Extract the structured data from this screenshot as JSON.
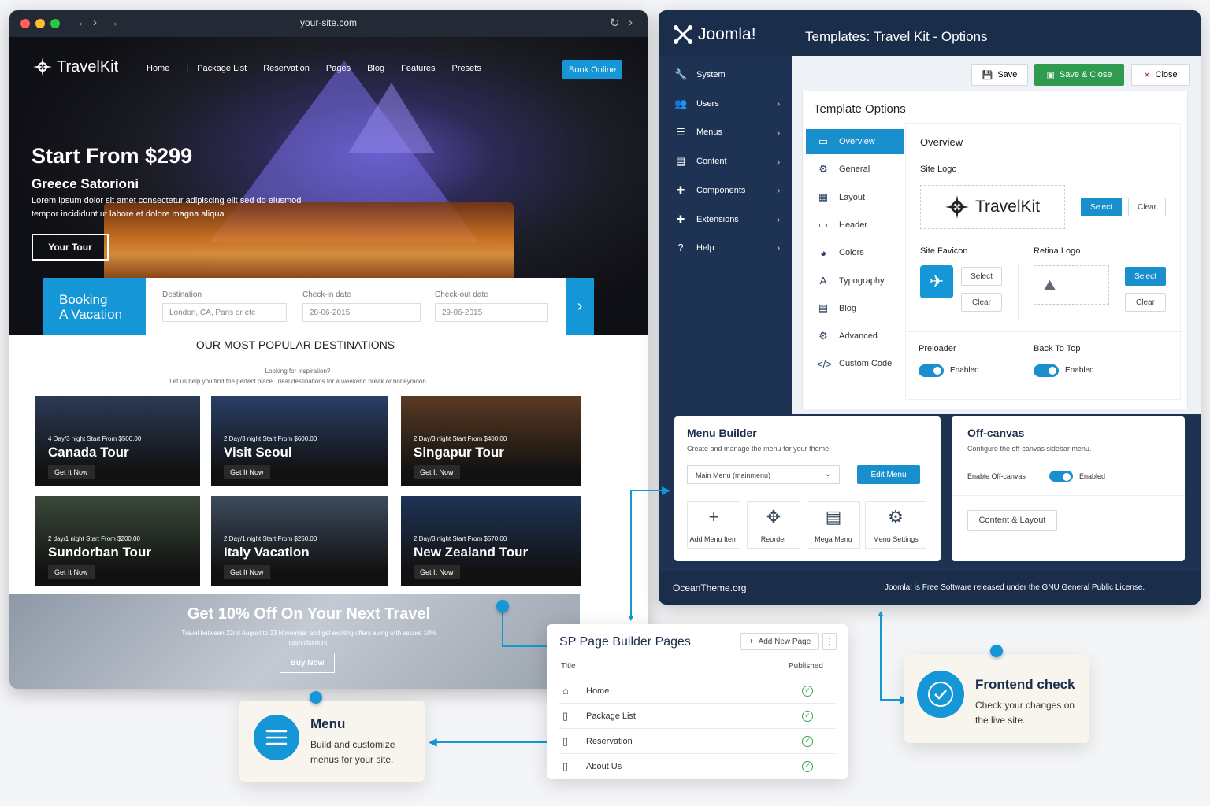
{
  "browser": {
    "url": "your-site.com"
  },
  "site": {
    "logo": "TravelKit",
    "nav": [
      "Home",
      "Package List",
      "Reservation",
      "Pages",
      "Blog",
      "Features",
      "Presets"
    ],
    "book_online": "Book Online",
    "hero": {
      "title": "Start From $299",
      "subtitle": "Greece Satorioni",
      "desc": "Lorem ipsum dolor sit amet consectetur adipiscing elit sed do eiusmod tempor incididunt ut labore et dolore magna aliqua",
      "cta": "Your Tour"
    },
    "booking": {
      "title_line1": "Booking",
      "title_line2": "A Vacation",
      "destination_label": "Destination",
      "destination_placeholder": "London, CA, Paris or etc",
      "checkin_label": "Check-in date",
      "checkin_value": "28-06-2015",
      "checkout_label": "Check-out date",
      "checkout_value": "29-06-2015"
    },
    "popular": {
      "title": "OUR MOST POPULAR DESTINATIONS",
      "sub1": "Looking for inspiration?",
      "sub2": "Let us help you find the perfect place. Ideal destinations for a weekend break or honeymoon",
      "cards": [
        {
          "tag": "4 Day/3 night Start From $500.00",
          "name": "Canada Tour",
          "btn": "Get It Now",
          "bg": "#2b3a55"
        },
        {
          "tag": "2 Day/3 night Start From $600.00",
          "name": "Visit Seoul",
          "btn": "Get It Now",
          "bg": "#2a3f66"
        },
        {
          "tag": "2 Day/3 night Start From $400.00",
          "name": "Singapur Tour",
          "btn": "Get It Now",
          "bg": "#5a3a22"
        },
        {
          "tag": "2 day/1 night Start From $200.00",
          "name": "Sundorban Tour",
          "btn": "Get It Now",
          "bg": "#3a4a3a"
        },
        {
          "tag": "2 Day/1 night Start From $250.00",
          "name": "Italy Vacation",
          "btn": "Get It Now",
          "bg": "#3d4a5e"
        },
        {
          "tag": "2 Day/3 night Start From $570.00",
          "name": "New Zealand Tour",
          "btn": "Get It Now",
          "bg": "#1f3456"
        }
      ]
    },
    "promo": {
      "title": "Get 10% Off On Your Next Travel",
      "desc": "Travel between 22nd August to 23 November and get exciting offers along with secure 10% cash discount.",
      "cta": "Buy Now"
    }
  },
  "joomla": {
    "logo": "Joomla!",
    "title": "Templates: Travel Kit - Options",
    "sidebar": [
      {
        "label": "System",
        "icon": "wrench-icon",
        "chevron": false
      },
      {
        "label": "Users",
        "icon": "users-icon",
        "chevron": true
      },
      {
        "label": "Menus",
        "icon": "list-icon",
        "chevron": true
      },
      {
        "label": "Content",
        "icon": "file-icon",
        "chevron": true
      },
      {
        "label": "Components",
        "icon": "puzzle-icon",
        "chevron": true
      },
      {
        "label": "Extensions",
        "icon": "puzzle-icon",
        "chevron": true
      },
      {
        "label": "Help",
        "icon": "help-icon",
        "chevron": true
      }
    ],
    "toolbar": {
      "save": "Save",
      "save_close": "Save & Close",
      "close": "Close"
    },
    "options": {
      "title": "Template Options",
      "tabs": [
        {
          "label": "Overview",
          "icon": "monitor-icon",
          "active": true
        },
        {
          "label": "General",
          "icon": "gear-icon"
        },
        {
          "label": "Layout",
          "icon": "grid-icon"
        },
        {
          "label": "Header",
          "icon": "header-icon"
        },
        {
          "label": "Colors",
          "icon": "palette-icon"
        },
        {
          "label": "Typography",
          "icon": "type-icon"
        },
        {
          "label": "Blog",
          "icon": "blog-icon"
        },
        {
          "label": "Advanced",
          "icon": "gear-icon"
        },
        {
          "label": "Custom Code",
          "icon": "code-icon"
        }
      ],
      "overview": {
        "heading": "Overview",
        "site_logo_label": "Site Logo",
        "site_logo_text": "TravelKit",
        "select": "Select",
        "clear": "Clear",
        "site_favicon_label": "Site Favicon",
        "retina_logo_label": "Retina Logo",
        "preloader_label": "Preloader",
        "preloader_value": "Enabled",
        "back_to_top_label": "Back To Top",
        "back_to_top_value": "Enabled"
      }
    },
    "menu_builder": {
      "title": "Menu Builder",
      "desc": "Create and manage the menu for your theme.",
      "select_value": "Main Menu (mainmenu)",
      "edit_menu": "Edit Menu",
      "tiles": [
        {
          "label": "Add Menu Item",
          "icon": "plus-icon"
        },
        {
          "label": "Reorder",
          "icon": "move-icon"
        },
        {
          "label": "Mega Menu",
          "icon": "mega-menu-icon"
        },
        {
          "label": "Menu Settings",
          "icon": "gear-icon"
        }
      ]
    },
    "offcanvas": {
      "title": "Off-canvas",
      "desc": "Configure the off-canvas sidebar menu.",
      "enable_label": "Enable Off-canvas",
      "enable_value": "Enabled",
      "content_layout": "Content & Layout"
    },
    "footer": {
      "left": "OceanTheme.org",
      "right": "Joomla! is Free Software released under the GNU General Public License."
    }
  },
  "sp": {
    "title": "SP Page Builder Pages",
    "add_new": "Add New Page",
    "col_title": "Title",
    "col_published": "Published",
    "rows": [
      {
        "title": "Home",
        "icon": "home-icon"
      },
      {
        "title": "Package List",
        "icon": "page-icon"
      },
      {
        "title": "Reservation",
        "icon": "page-icon"
      },
      {
        "title": "About Us",
        "icon": "page-icon"
      }
    ]
  },
  "callouts": {
    "menu": {
      "title": "Menu",
      "desc": "Build and customize menus for your site."
    },
    "frontend": {
      "title": "Frontend check",
      "desc": "Check your changes on the live site."
    }
  },
  "colors": {
    "accent": "#1596d6",
    "joomla_bg": "#1e3354",
    "success": "#2e9b4e"
  }
}
